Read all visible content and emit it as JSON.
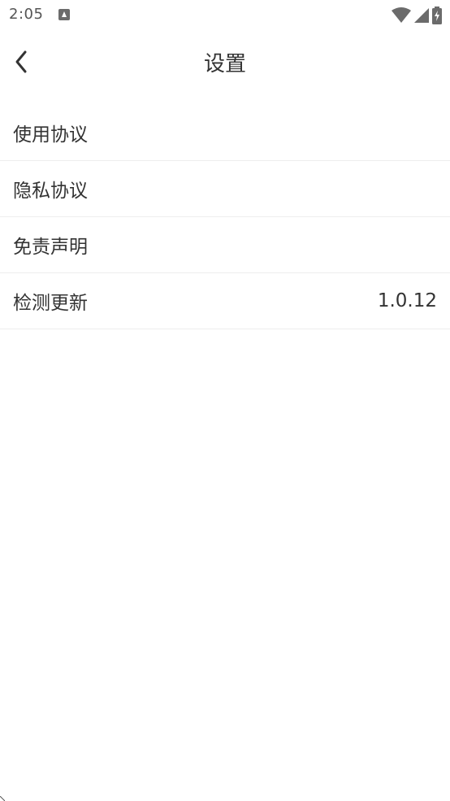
{
  "status_bar": {
    "time": "2:05",
    "notification_icon": "text-a-icon",
    "wifi_icon": "wifi-icon",
    "signal_icon": "cell-signal-icon",
    "battery_icon": "battery-charging-icon"
  },
  "header": {
    "back_icon": "chevron-left-icon",
    "title": "设置"
  },
  "menu": {
    "items": [
      {
        "label": "使用协议",
        "value": ""
      },
      {
        "label": "隐私协议",
        "value": ""
      },
      {
        "label": "免责声明",
        "value": ""
      },
      {
        "label": "检测更新",
        "value": "1.0.12"
      }
    ]
  },
  "colors": {
    "text": "#333333",
    "divider": "#eeeeee",
    "background": "#ffffff",
    "status_icon": "#6b6b6b"
  }
}
